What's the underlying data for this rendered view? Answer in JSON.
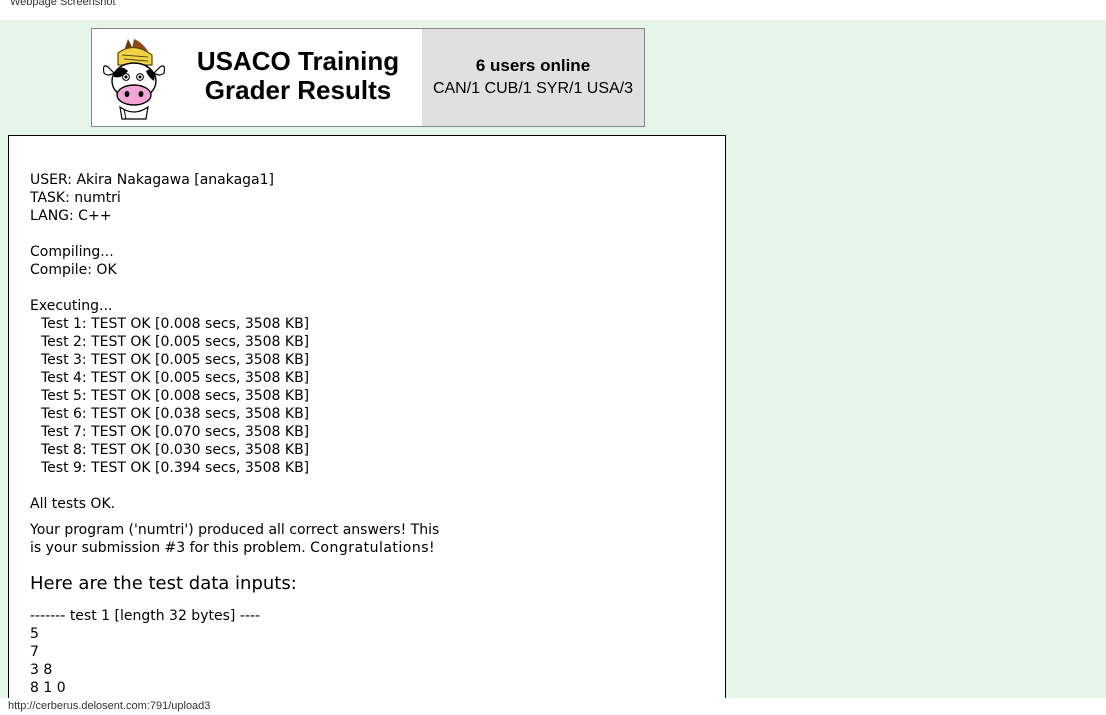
{
  "window": {
    "title": "Webpage Screenshot"
  },
  "banner": {
    "title_line1": "USACO Training",
    "title_line2": "Grader Results",
    "online_count": "6 users online",
    "online_countries": "CAN/1 CUB/1 SYR/1 USA/3"
  },
  "submission": {
    "user": "USER: Akira Nakagawa [anakaga1]",
    "task": "TASK: numtri",
    "lang": "LANG: C++",
    "compiling": "Compiling...",
    "compile_status": "Compile: OK",
    "executing": "Executing...",
    "tests": [
      "Test 1: TEST OK [0.008 secs, 3508 KB]",
      "Test 2: TEST OK [0.005 secs, 3508 KB]",
      "Test 3: TEST OK [0.005 secs, 3508 KB]",
      "Test 4: TEST OK [0.005 secs, 3508 KB]",
      "Test 5: TEST OK [0.008 secs, 3508 KB]",
      "Test 6: TEST OK [0.038 secs, 3508 KB]",
      "Test 7: TEST OK [0.070 secs, 3508 KB]",
      "Test 8: TEST OK [0.030 secs, 3508 KB]",
      "Test 9: TEST OK [0.394 secs, 3508 KB]"
    ],
    "all_ok": "All tests OK.",
    "message": "Your program ('numtri') produced all correct answers!  This is your submission #3 for this problem.",
    "congrats": "Congratulations!",
    "inputs_heading": "Here are the test data inputs:",
    "test1_header": "------- test 1 [length 32 bytes] ----",
    "test1_data": [
      "5",
      "7",
      "3 8",
      "8 1 0"
    ]
  },
  "statusbar": {
    "url": "http://cerberus.delosent.com:791/upload3"
  }
}
